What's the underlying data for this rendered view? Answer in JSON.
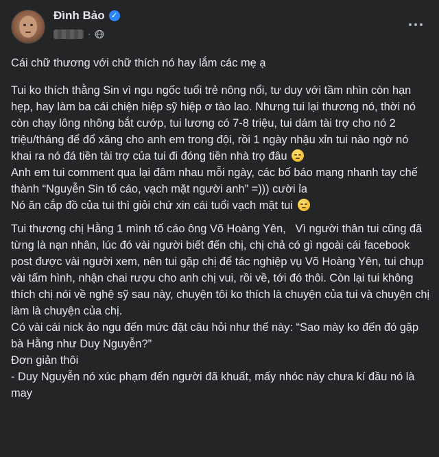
{
  "post": {
    "author": "Đình Bảo",
    "verified_icon": "verified-badge-icon",
    "privacy_icon": "globe-icon",
    "more_icon": "more-options-icon",
    "separator": "·"
  },
  "content": {
    "p1": "Cái chữ thương với chữ thích nó hay lắm các mẹ ạ",
    "p2a": "Tui ko thích thằng Sin vì ngu ngốc tuổi trẻ nông nổi, tư duy với tầm nhìn còn hạn hẹp, hay làm ba cái chiện hiệp sỹ hiệp ơ tào lao. Nhưng tui lại thương nó, thời nó còn chạy lông nhông bắt cướp, tui lương có 7-8 triệu, tui dám tài trợ cho nó 2 triệu/tháng để đổ xăng cho anh em trong đội, rồi 1 ngày nhậu xỉn tui nào ngờ nó khai ra nó đá tiền tài trợ của tui đi đóng tiền nhà trọ đâu",
    "p2b": "Anh em tui comment qua lại đâm nhau mỗi ngày, các bố báo mạng nhanh tay chế thành “Nguyễn Sin tố cáo, vạch mặt người anh” =))) cười ỉa",
    "p2c": "Nó ăn cắp đồ của tui thì giỏi chứ xin cái tuổi vạch mặt tui",
    "p3a": "Tui thương chị Hằng 1 mình tố cáo ông Võ Hoàng Yên,   Vì người thân tui cũng đã từng là nạn nhân, lúc đó vài người biết đến chị, chị chả có gì ngoài cái facebook post được vài người xem, nên tui gặp chị để tác nghiệp vụ Võ Hoàng Yên, tui chụp vài tấm hình, nhận chai rượu cho anh chị vui, rồi về, tới đó thôi. Còn lại tui không thích chị nói về nghệ sỹ sau này, chuyện tôi ko thích là chuyện của tui và chuyện chị làm là chuyện của chị.",
    "p3b": "Có vài cái nick ảo ngu đến mức đặt câu hỏi như thế này: “Sao mày ko đến đó gặp bà Hằng như Duy Nguyễn?”",
    "p3c": "Đơn giản thôi",
    "p3d": "- Duy Nguyễn nó xúc phạm đến người đã khuất, mấy nhóc này chưa kí đầu nó là may"
  }
}
